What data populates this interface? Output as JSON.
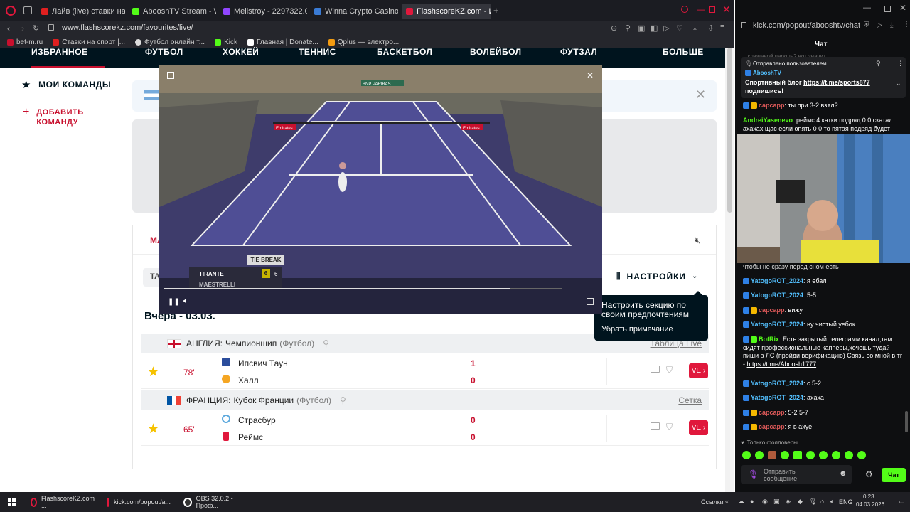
{
  "left_browser": {
    "tabs": [
      {
        "label": "Лайв (live) ставки на т",
        "icon": "fonbet-icon",
        "color": "#e02020"
      },
      {
        "label": "AbooshTV Stream - Watc",
        "icon": "kick-icon",
        "color": "#53fc18"
      },
      {
        "label": "Mellstroy - 2297322.0726",
        "icon": "twitch-icon",
        "color": "#9146ff"
      },
      {
        "label": "Winna Crypto Casino - Be",
        "icon": "winna-icon",
        "color": "#3a7bd5"
      },
      {
        "label": "FlashscoreKZ.com - Избр",
        "icon": "flashscore-icon",
        "color": "#e0183c"
      }
    ],
    "url": "www.flashscorekz.com/favourites/live/",
    "bookmarks": [
      "bet-m.ru",
      "Ставки на спорт |...",
      "Футбол онлайн т...",
      "Kick",
      "Главная | Donate...",
      "Qplus — электро..."
    ]
  },
  "site": {
    "nav": [
      "ИЗБРАННОЕ",
      "ФУТБОЛ",
      "ХОККЕЙ",
      "ТЕННИС",
      "БАСКЕТБОЛ",
      "ВОЛЕЙБОЛ",
      "ФУТЗАЛ",
      "БОЛЬШЕ"
    ],
    "sidebar": {
      "my_teams": "МОИ КОМАНДЫ",
      "add_team": "ДОБАВИТЬ КОМАНДУ"
    },
    "tab_left_partial": "МА",
    "filter_partial": "ТА",
    "settings_label": "НАСТРОЙКИ",
    "date_header": "Вчера - 03.03.",
    "groups": [
      {
        "country": "АНГЛИЯ:",
        "league": "Чемпионшип",
        "sport": "(Футбол)",
        "flag": "england",
        "right_link": "Таблица Live",
        "match": {
          "minute": "78'",
          "home": "Ипсвич Таун",
          "away": "Халл",
          "home_score": "1",
          "away_score": "0"
        }
      },
      {
        "country": "ФРАНЦИЯ:",
        "league": "Кубок Франции",
        "sport": "(Футбол)",
        "flag": "france",
        "right_link": "Сетка",
        "match": {
          "minute": "65'",
          "home": "Страсбур",
          "away": "Реймс",
          "home_score": "0",
          "away_score": "0"
        }
      }
    ],
    "live_btn": "VE",
    "tooltip": {
      "text": "Настроить секцию по своим предпочтениям",
      "dismiss": "Убрать примечание"
    }
  },
  "video": {
    "tiebreak_label": "TIE BREAK",
    "player1": "TIRANTE",
    "p1_games": "6",
    "p1_points": "6",
    "player2_partial": "MAESTRELLI",
    "progress": 0.87,
    "sponsor_banner": "Emirates",
    "net_sponsor": "BNP PARIBAS"
  },
  "right_browser": {
    "url": "kick.com/popout/abooshtv/chat",
    "chat_title": "Чат",
    "pinned": {
      "sent_by": "Отправлено пользователем",
      "user": "AbooshTV",
      "text_prefix": "Спортивный блог",
      "link": "https://t.me/sports877",
      "text_suffix": "подпишись!",
      "top_partial": "...ключевой пароль? вот значит..."
    },
    "messages_top": [
      {
        "user": "capcapp",
        "text": "ты при 3-2 взял?",
        "style": "red"
      },
      {
        "user": "AndreiYasenevo",
        "text": "реймс 4 катки подряд 0 0 скатал ахахах щас если опять 0 0 то пятая подряд будет",
        "style": "green"
      }
    ],
    "messages_bottom": [
      {
        "user": "",
        "text": "чтобы не сразу перед сном есть",
        "style": "none"
      },
      {
        "user": "YatogoROT_2024",
        "text": "я ебал",
        "style": "blue"
      },
      {
        "user": "YatogoROT_2024",
        "text": "5-5",
        "style": "blue"
      },
      {
        "user": "capcapp",
        "text": "вижу",
        "style": "red"
      },
      {
        "user": "YatogoROT_2024",
        "text": "ну чистый уебок",
        "style": "blue"
      },
      {
        "user": "BotRix",
        "text": "Есть закрытый телеграмм канал,там сидят профессиональные капперы,хочешь туда? пиши в ЛС (пройди верификацию) Связь со мной в тг -",
        "link": "https://t.me/Aboosh1777",
        "style": "blue"
      },
      {
        "user": "YatogoROT_2024",
        "text": "с 5-2",
        "style": "blue"
      },
      {
        "user": "YatogoROT_2024",
        "text": "ахаха",
        "style": "blue"
      },
      {
        "user": "capcapp",
        "text": "5-2 5-7",
        "style": "red"
      },
      {
        "user": "capcapp",
        "text": "я в ахуе",
        "style": "red"
      }
    ],
    "followers_only": "Только фолловеры",
    "input_placeholder": "Отправить сообщение",
    "chat_button": "Чат"
  },
  "taskbar": {
    "items": [
      "FlashscoreKZ.com ...",
      "kick.com/popout/a...",
      "OBS 32.0.2 - Проф..."
    ],
    "links_label": "Ссылки",
    "lang": "ENG",
    "time": "0:23",
    "date": "04.03.2026"
  }
}
